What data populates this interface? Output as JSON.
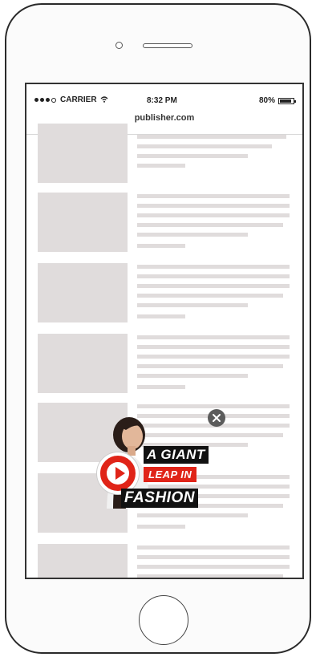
{
  "status_bar": {
    "carrier": "CARRIER",
    "time": "8:32 PM",
    "battery": "80%",
    "wifi_icon": "wifi-icon"
  },
  "url_bar": {
    "domain": "publisher.com"
  },
  "ad": {
    "close_icon": "close-icon",
    "play_icon": "play-icon",
    "line1": "A GIANT",
    "line2": "LEAP IN",
    "line3": "FASHION",
    "accent_color": "#e02418",
    "dark_color": "#111111"
  },
  "placeholder_color": "#e0dcdc"
}
